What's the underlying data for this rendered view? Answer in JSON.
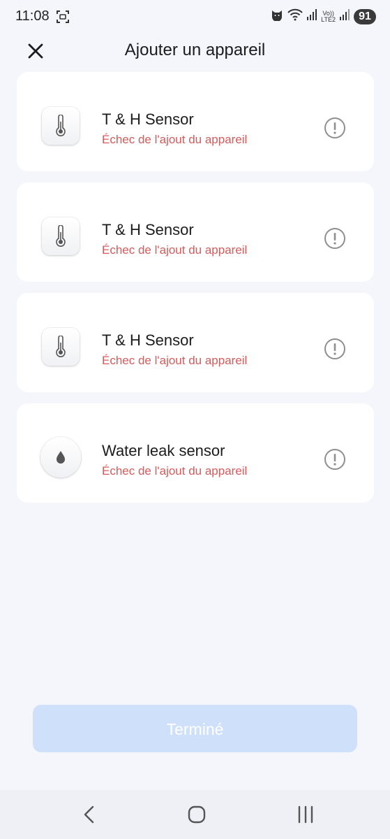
{
  "status_bar": {
    "time": "11:08",
    "battery": "91",
    "network_top": "Vo))",
    "network_bottom": "LTE2"
  },
  "header": {
    "title": "Ajouter un appareil"
  },
  "devices": [
    {
      "name": "T & H Sensor",
      "status": "Échec de l'ajout du appareil",
      "icon": "thermometer-icon"
    },
    {
      "name": "T & H Sensor",
      "status": "Échec de l'ajout du appareil",
      "icon": "thermometer-icon"
    },
    {
      "name": "T & H Sensor",
      "status": "Échec de l'ajout du appareil",
      "icon": "thermometer-icon"
    },
    {
      "name": "Water leak sensor",
      "status": "Échec de l'ajout du appareil",
      "icon": "water-drop-icon"
    }
  ],
  "done_button": {
    "label": "Terminé"
  },
  "colors": {
    "background": "#f4f6fb",
    "error": "#d65a5a",
    "button_disabled": "#cfe0fb"
  }
}
